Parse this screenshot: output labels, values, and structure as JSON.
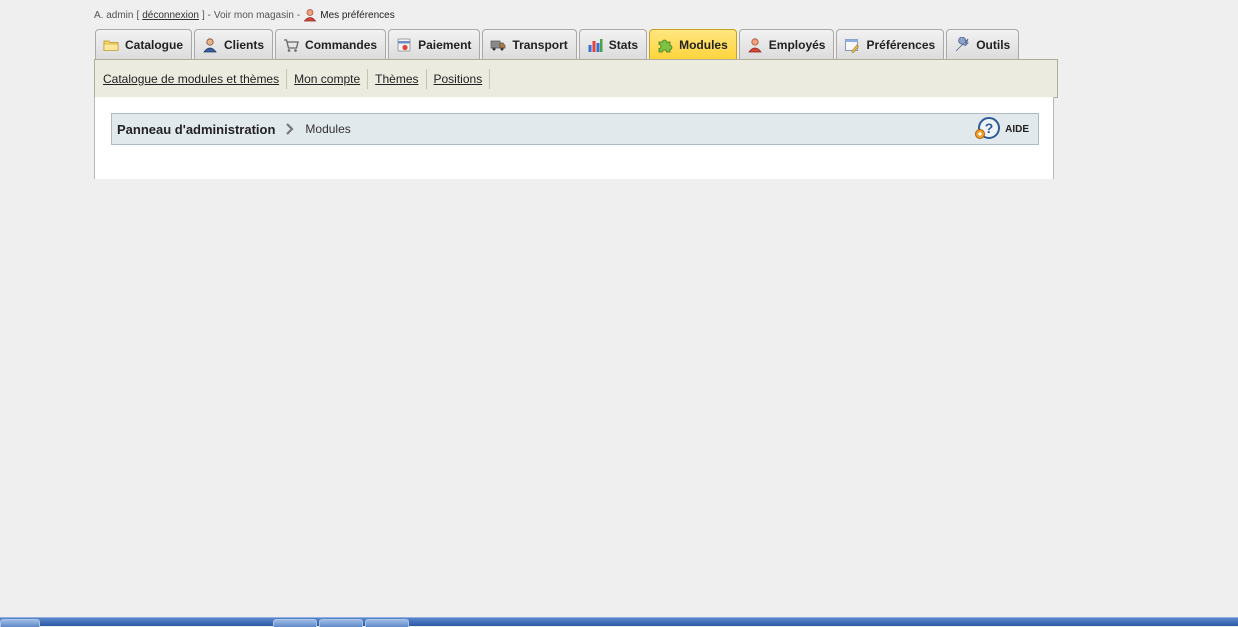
{
  "header": {
    "user": "A. admin",
    "bracket_open": "[",
    "logout": "déconnexion",
    "bracket_close_sep": "] -",
    "view_store": "Voir mon magasin",
    "sep": "-",
    "preferences": "Mes préférences"
  },
  "tabs": [
    {
      "label": "Catalogue",
      "icon": "folder-icon",
      "active": false
    },
    {
      "label": "Clients",
      "icon": "customer-icon",
      "active": false
    },
    {
      "label": "Commandes",
      "icon": "cart-icon",
      "active": false
    },
    {
      "label": "Paiement",
      "icon": "payment-icon",
      "active": false
    },
    {
      "label": "Transport",
      "icon": "truck-icon",
      "active": false
    },
    {
      "label": "Stats",
      "icon": "chart-icon",
      "active": false
    },
    {
      "label": "Modules",
      "icon": "puzzle-icon",
      "active": true
    },
    {
      "label": "Employés",
      "icon": "employee-icon",
      "active": false
    },
    {
      "label": "Préférences",
      "icon": "preferences-icon",
      "active": false
    },
    {
      "label": "Outils",
      "icon": "wrench-icon",
      "active": false
    }
  ],
  "submenu": [
    "Catalogue de modules et thèmes",
    "Mon compte",
    "Thèmes",
    "Positions"
  ],
  "breadcrumb": {
    "home": "Panneau d'administration",
    "current": "Modules"
  },
  "help": {
    "label": "AIDE"
  },
  "colors": {
    "active_tab": "#ffd43b",
    "breadcrumb_bg": "#e2e9ec",
    "submenu_bg": "#ecebdf"
  }
}
